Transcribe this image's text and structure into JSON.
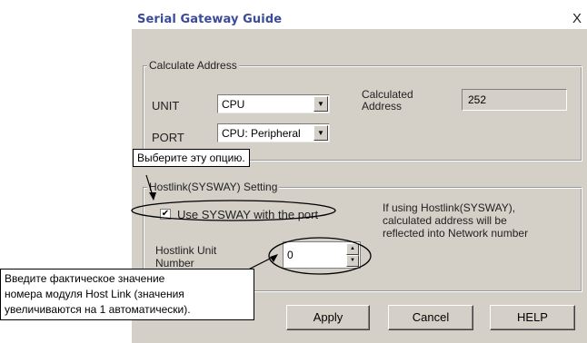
{
  "dialog": {
    "title": "Serial Gateway Guide",
    "close_label": "X"
  },
  "calc_group": {
    "legend": "Calculate Address",
    "unit_label": "UNIT",
    "unit_value": "CPU",
    "port_label": "PORT",
    "port_value": "CPU: Peripheral",
    "calc_label_line1": "Calculated",
    "calc_label_line2": "Address",
    "calc_value": "252"
  },
  "hostlink_group": {
    "legend": "Hostlink(SYSWAY) Setting",
    "checkbox_label": "Use SYSWAY with the port",
    "checkbox_checked": true,
    "checkbox_mark": "✔",
    "info_line1": "If using Hostlink(SYSWAY),",
    "info_line2": "calculated address will be",
    "info_line3": "reflected into Network number",
    "unit_number_label_line1": "Hostlink Unit",
    "unit_number_label_line2": "Number",
    "unit_number_value": "0"
  },
  "buttons": {
    "apply": "Apply",
    "cancel": "Cancel",
    "help": "HELP"
  },
  "icons": {
    "dropdown": "▼",
    "spin_up": "▲",
    "spin_down": "▼"
  },
  "annotations": {
    "select_option": "Выберите эту опцию.",
    "enter_value_line1": "Введите фактическое значение",
    "enter_value_line2": "номера модуля Host Link (значения",
    "enter_value_line3": "увеличиваются на 1 автоматически)."
  }
}
